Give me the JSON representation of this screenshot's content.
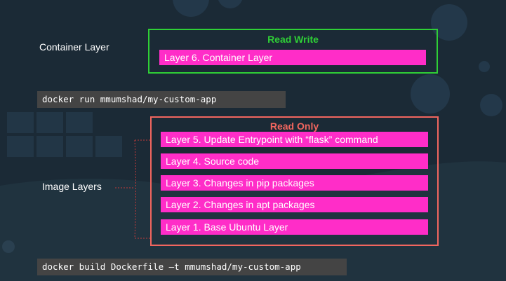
{
  "labels": {
    "container_layer": "Container Layer",
    "image_layers": "Image Layers"
  },
  "read_write": {
    "title": "Read Write",
    "layers": [
      "Layer 6. Container Layer"
    ]
  },
  "read_only": {
    "title": "Read Only",
    "layers": [
      "Layer 5. Update Entrypoint with “flask” command",
      "Layer 4. Source code",
      "Layer 3. Changes in pip packages",
      "Layer 2. Changes in apt packages",
      "Layer 1. Base Ubuntu Layer"
    ]
  },
  "commands": {
    "run": "docker run mmumshad/my-custom-app",
    "build": "docker build Dockerfile –t mmumshad/my-custom-app"
  },
  "colors": {
    "background": "#1b2a36",
    "read_write_accent": "#2fcf36",
    "read_only_accent": "#f2665f",
    "layer_fill": "#ff2dc8",
    "command_fill": "#444444"
  }
}
